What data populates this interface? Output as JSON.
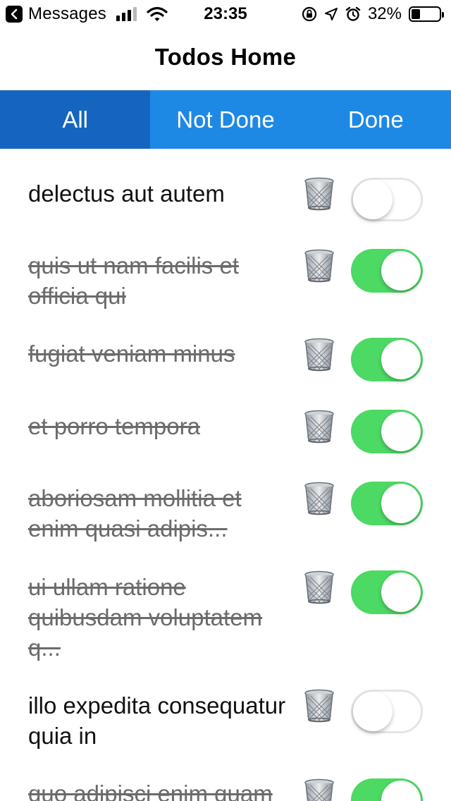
{
  "status_bar": {
    "back_app": "Messages",
    "time": "23:35",
    "battery_percent": "32%",
    "battery_level": 0.32,
    "icons": [
      "back-chevron-icon",
      "cellular-signal-icon",
      "wifi-icon",
      "orientation-lock-icon",
      "location-arrow-icon",
      "alarm-clock-icon",
      "battery-icon"
    ]
  },
  "header": {
    "title": "Todos Home"
  },
  "tabs": [
    {
      "label": "All",
      "active": true
    },
    {
      "label": "Not Done",
      "active": false
    },
    {
      "label": "Done",
      "active": false
    }
  ],
  "todos": [
    {
      "text": "delectus aut autem",
      "done": false
    },
    {
      "text": "quis ut nam facilis et officia qui",
      "done": true
    },
    {
      "text": "fugiat veniam minus",
      "done": true
    },
    {
      "text": "et porro tempora",
      "done": true
    },
    {
      "text": "aboriosam mollitia et enim quasi adipis...",
      "done": true
    },
    {
      "text": "ui ullam ratione quibusdam voluptatem q...",
      "done": true
    },
    {
      "text": "illo expedita consequatur quia in",
      "done": false
    },
    {
      "text": "quo adipisci enim quam",
      "done": true
    }
  ],
  "colors": {
    "tab_bar": "#1e88e5",
    "tab_active": "#1565c0",
    "switch_on": "#4cd964",
    "switch_off_border": "#e5e5e5",
    "done_text": "#6b6b6b"
  }
}
